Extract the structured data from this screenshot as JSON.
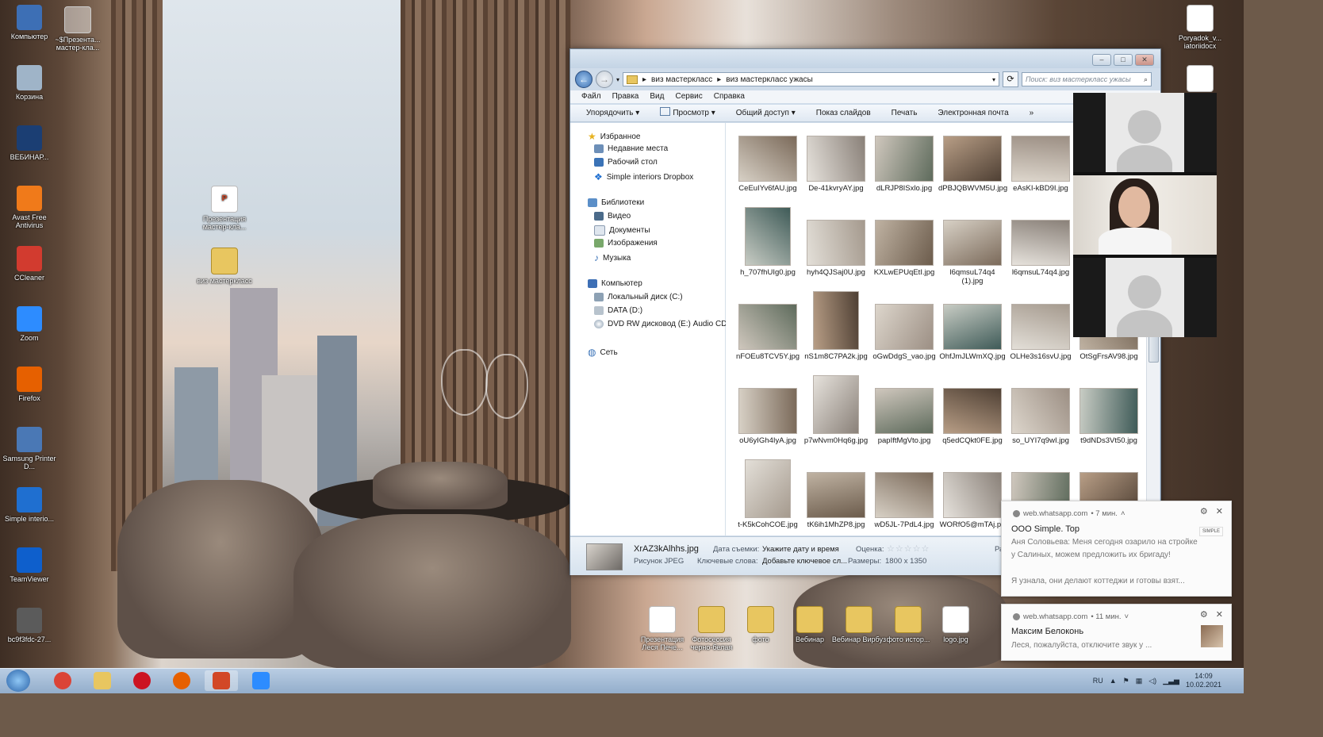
{
  "desktop": {
    "left_icons": [
      {
        "label": "Компьютер",
        "icon": "computer-icon",
        "color": "#3d6fb5"
      },
      {
        "label": "Корзина",
        "icon": "recycle-bin-icon",
        "color": "#9fb4c8"
      },
      {
        "label": "ВЕБИНАР...",
        "icon": "photoshop-icon",
        "color": "#1b3e73"
      },
      {
        "label": "Avast Free Antivirus",
        "icon": "avast-icon",
        "color": "#f07a1a"
      },
      {
        "label": "CCleaner",
        "icon": "ccleaner-icon",
        "color": "#d23b2f"
      },
      {
        "label": "Zoom",
        "icon": "zoom-icon",
        "color": "#2d8cff"
      },
      {
        "label": "Firefox",
        "icon": "firefox-icon",
        "color": "#e66000"
      },
      {
        "label": "Samsung Printer D...",
        "icon": "printer-icon",
        "color": "#4a78b5"
      },
      {
        "label": "Simple interio...",
        "icon": "dropbox-icon",
        "color": "#1f6fd0"
      },
      {
        "label": "TeamViewer",
        "icon": "teamviewer-icon",
        "color": "#0e5fcc"
      },
      {
        "label": "bc9f3fdc-27...",
        "icon": "file-icon",
        "color": "#5b5b5b"
      }
    ],
    "top_icon": {
      "label": "~$Презента... мастер-кла...",
      "icon": "word-temp-icon"
    },
    "middle_icons": [
      {
        "label": "Презентация мастер-кла...",
        "icon": "presentation-icon"
      },
      {
        "label": "виз мастеркласс",
        "icon": "zip-folder-icon"
      }
    ],
    "right_icons": [
      {
        "label": "Poryadok_v... iatoriidocx",
        "icon": "document-icon"
      },
      {
        "label": "",
        "icon": "document-icon"
      }
    ],
    "bottom_icons": [
      {
        "label": "Презентация Леся Пече...",
        "icon": "presentation-file-icon"
      },
      {
        "label": "Фотосессия черно-белая",
        "icon": "folder-icon"
      },
      {
        "label": "фото",
        "icon": "folder-icon"
      },
      {
        "label": "Вебинар",
        "icon": "folder-icon"
      },
      {
        "label": "Вебинар Вирбуз",
        "icon": "folder-icon"
      },
      {
        "label": "фото истор...",
        "icon": "folder-icon"
      },
      {
        "label": "logo.jpg",
        "icon": "image-file-icon"
      }
    ]
  },
  "explorer": {
    "breadcrumb": [
      "виз мастеркласс",
      "виз мастеркласс ужасы"
    ],
    "search_placeholder": "Поиск: виз мастеркласс ужасы",
    "menu": [
      "Файл",
      "Правка",
      "Вид",
      "Сервис",
      "Справка"
    ],
    "toolbar": [
      "Упорядочить ▾",
      "Просмотр ▾",
      "Общий доступ ▾",
      "Показ слайдов",
      "Печать",
      "Электронная почта",
      "»"
    ],
    "nav": {
      "favorites": {
        "label": "Избранное",
        "items": [
          "Недавние места",
          "Рабочий стол",
          "Simple interiors Dropbox"
        ]
      },
      "libraries": {
        "label": "Библиотеки",
        "items": [
          "Видео",
          "Документы",
          "Изображения",
          "Музыка"
        ]
      },
      "computer": {
        "label": "Компьютер",
        "items": [
          "Локальный диск (C:)",
          "DATA (D:)",
          "DVD RW дисковод (E:) Audio CD"
        ]
      },
      "network": {
        "label": "Сеть"
      }
    },
    "files": [
      [
        "CeEuIYv6fAU.jpg",
        "De-41kvryAY.jpg",
        "dLRJP8ISxlo.jpg",
        "dPBJQBWVM5U.jpg",
        "eAsKI-kBD9I.jpg"
      ],
      [
        "h_707fhUIg0.jpg",
        "hyh4QJSaj0U.jpg",
        "KXLwEPUqEtI.jpg",
        "l6qmsuL74q4 (1).jpg",
        "l6qmsuL74q4.jpg"
      ],
      [
        "nFOEu8TCV5Y.jpg",
        "nS1m8C7PA2k.jpg",
        "oGwDdgS_vao.jpg",
        "OhfJmJLWmXQ.jpg",
        "OLHe3s16svU.jpg",
        "OtSgFrsAV98.jpg"
      ],
      [
        "oU6yIGh4IyA.jpg",
        "p7wNvm0Hq6g.jpg",
        "papIftMgVto.jpg",
        "q5edCQkt0FE.jpg",
        "so_UYI7q9wI.jpg",
        "t9dNDs3Vt50.jpg"
      ],
      [
        "t-K5kCohCOE.jpg",
        "tK6ih1MhZP8.jpg",
        "wD5JL-7PdL4.jpg",
        "WORfO5@mTAj.pg",
        "",
        ""
      ]
    ],
    "details": {
      "filename": "XrAZ3kAlhhs.jpg",
      "type": "Рисунок JPEG",
      "date_label": "Дата съемки:",
      "date_value": "Укажите дату и время",
      "rating_label": "Оценка:",
      "keywords_label": "Ключевые слова:",
      "keywords_value": "Добавьте ключевое сл...",
      "size_label": "Размеры:",
      "size_value": "1800 x 1350",
      "cut_label": "Разм"
    }
  },
  "notifications": [
    {
      "source": "web.whatsapp.com",
      "time": "• 7 мин.",
      "title": "ООО Simple. Top",
      "lines": [
        "Аня Соловьева: Меня сегодня озарило на стройке у Салиных, можем предложить их бригаду!",
        "Я узнала, они делают коттеджи и готовы взят..."
      ],
      "badge": "SIMPLE"
    },
    {
      "source": "web.whatsapp.com",
      "time": "• 11 мин.",
      "title": "Максим Белоконь",
      "lines": [
        "Леся, пожалуйста, отключите звук у ..."
      ]
    }
  ],
  "taskbar": {
    "apps": [
      {
        "name": "chrome-icon",
        "color": "#db4437"
      },
      {
        "name": "explorer-icon",
        "color": "#e8c660"
      },
      {
        "name": "opera-icon",
        "color": "#cc1422"
      },
      {
        "name": "firefox-icon",
        "color": "#e66000"
      },
      {
        "name": "powerpoint-icon",
        "color": "#d24726"
      },
      {
        "name": "zoom-icon",
        "color": "#2d8cff"
      }
    ],
    "language": "RU",
    "time": "14:09",
    "date": "10.02.2021"
  }
}
